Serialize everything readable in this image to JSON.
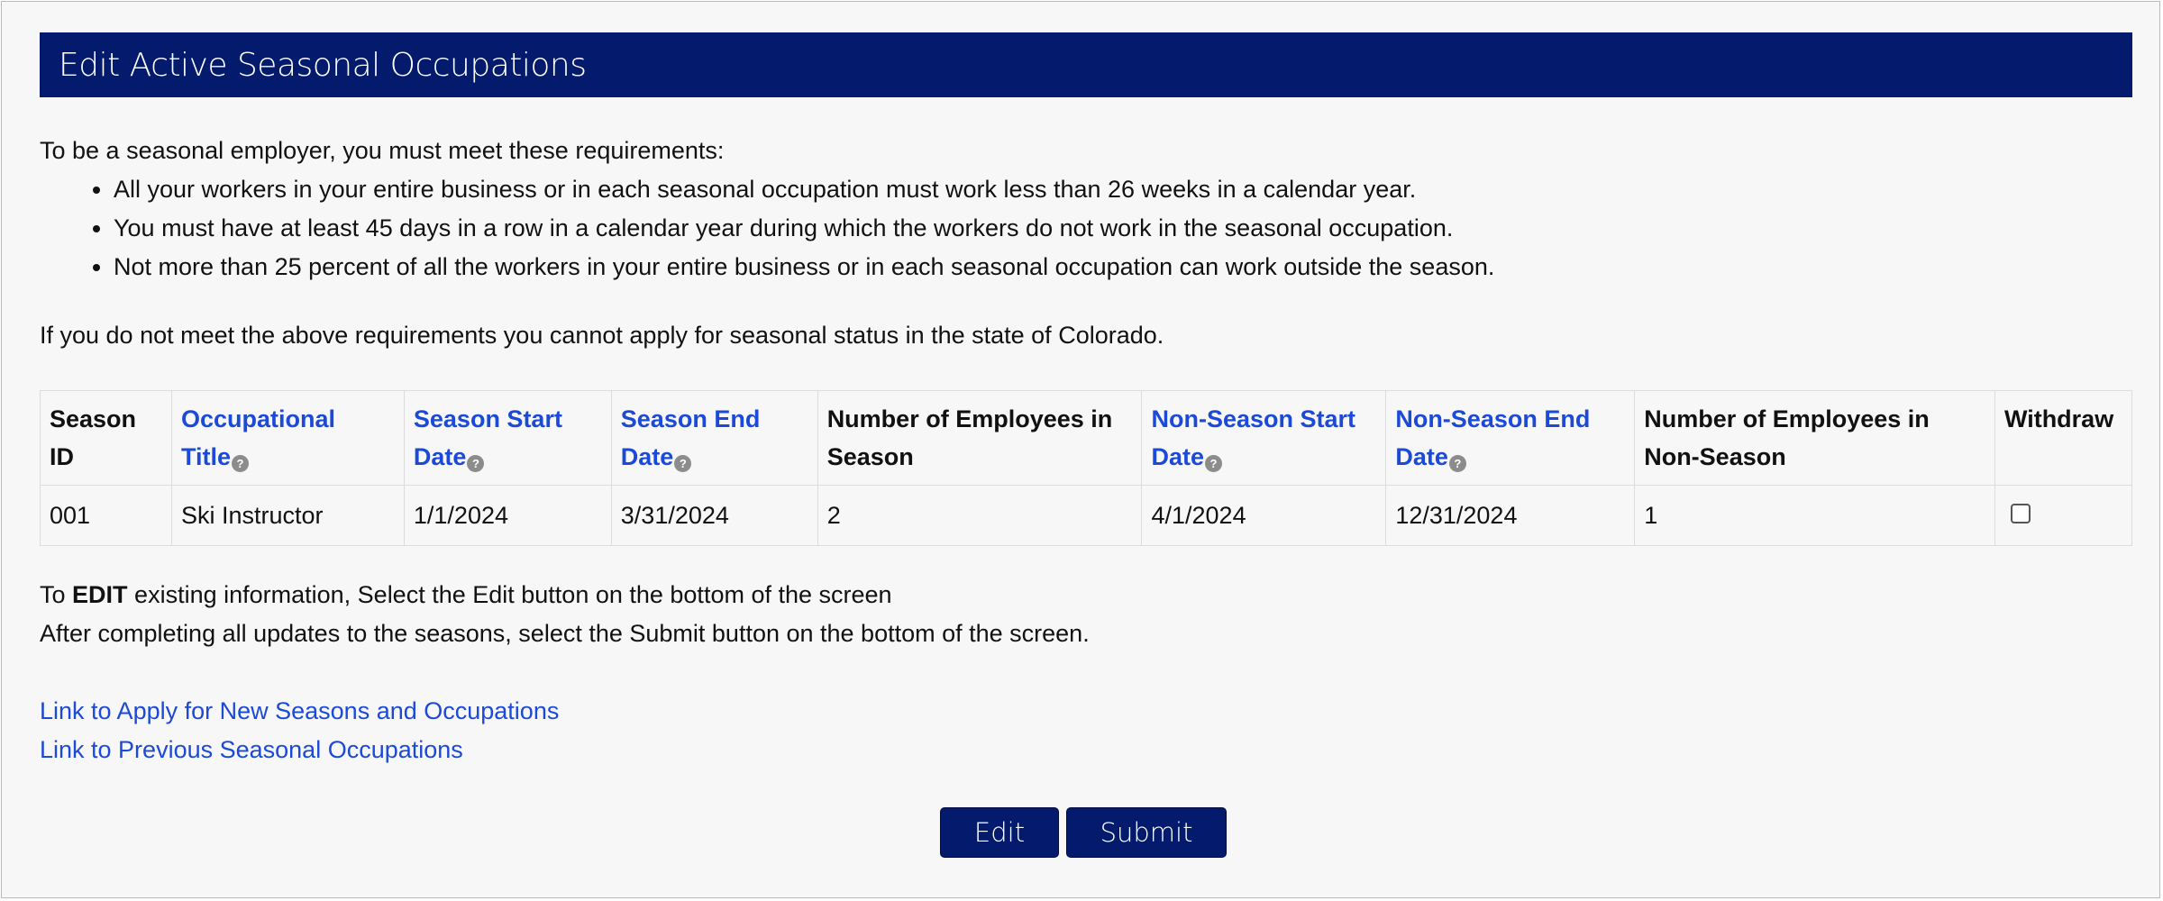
{
  "header": {
    "title": "Edit Active Seasonal Occupations"
  },
  "intro": {
    "lead": "To be a seasonal employer, you must meet these requirements:",
    "requirements": [
      "All your workers in your entire business or in each seasonal occupation must work less than 26 weeks in a calendar year.",
      "You must have at least 45 days in a row in a calendar year during which the workers do not work in the seasonal occupation.",
      "Not more than 25 percent of all the workers in your entire business or in each seasonal occupation can work outside the season."
    ],
    "notice": "If you do not meet the above requirements you cannot apply for seasonal status in the state of Colorado."
  },
  "table": {
    "columns": [
      {
        "line1": "Season",
        "line2": "ID"
      },
      {
        "line1": "Occupational",
        "line2": "Title",
        "help": "?"
      },
      {
        "line1": "Season Start",
        "line2": "Date",
        "help": "?"
      },
      {
        "line1": "Season End",
        "line2": "Date",
        "help": "?"
      },
      {
        "line1": "Number of Employees in",
        "line2": "Season"
      },
      {
        "line1": "Non-Season Start",
        "line2": "Date",
        "help": "?"
      },
      {
        "line1": "Non-Season End",
        "line2": "Date",
        "help": "?"
      },
      {
        "line1": "Number of Employees in",
        "line2": "Non-Season"
      },
      {
        "line1": "Withdraw"
      }
    ],
    "rows": [
      {
        "season_id": "001",
        "occupational_title": "Ski Instructor",
        "season_start": "1/1/2024",
        "season_end": "3/31/2024",
        "employees_season": "2",
        "non_season_start": "4/1/2024",
        "non_season_end": "12/31/2024",
        "employees_non_season": "1",
        "withdraw": false
      }
    ]
  },
  "instructions": {
    "edit_prefix": "To ",
    "edit_bold": "EDIT",
    "edit_suffix": " existing information, Select the Edit button on the bottom of the screen",
    "submit_line": "After completing all updates to the seasons, select the Submit button on the bottom of the screen."
  },
  "links": {
    "apply_new": "Link to Apply for New Seasons and Occupations",
    "previous": "Link to Previous Seasonal Occupations"
  },
  "actions": {
    "edit_label": "Edit",
    "submit_label": "Submit"
  },
  "colors": {
    "header_bg": "#031a6d",
    "link": "#1b49d8",
    "page_bg": "#f7f7f7"
  }
}
